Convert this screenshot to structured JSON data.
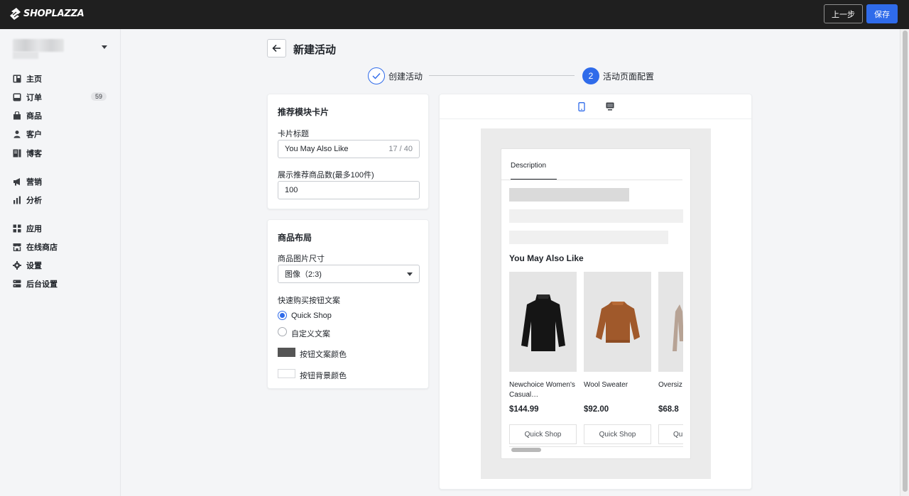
{
  "topbar": {
    "logo_text": "SHOPLAZZA",
    "prev_label": "上一步",
    "save_label": "保存",
    "colors": {
      "bar": "#1f1f1f",
      "primary": "#2f6bea"
    }
  },
  "sidebar": {
    "items": [
      {
        "label": "主页",
        "icon": "home-icon"
      },
      {
        "label": "订单",
        "icon": "inbox-icon",
        "badge": "59"
      },
      {
        "label": "商品",
        "icon": "bag-icon"
      },
      {
        "label": "客户",
        "icon": "person-icon"
      },
      {
        "label": "博客",
        "icon": "blog-icon"
      },
      {
        "label": "营销",
        "icon": "megaphone-icon"
      },
      {
        "label": "分析",
        "icon": "bar-chart-icon"
      },
      {
        "label": "应用",
        "icon": "apps-icon"
      },
      {
        "label": "在线商店",
        "icon": "store-icon"
      },
      {
        "label": "设置",
        "icon": "gear-icon"
      },
      {
        "label": "后台设置",
        "icon": "server-icon"
      }
    ]
  },
  "header": {
    "title": "新建活动"
  },
  "steps": [
    {
      "label": "创建活动",
      "state": "done"
    },
    {
      "number": "2",
      "label": "活动页面配置",
      "state": "active"
    }
  ],
  "card_module": {
    "title": "推荐模块卡片",
    "card_title_label": "卡片标题",
    "card_title_value": "You May Also Like",
    "card_title_counter": "17 / 40",
    "count_label": "展示推荐商品数(最多100件)",
    "count_value": "100"
  },
  "card_layout": {
    "title": "商品布局",
    "image_size_label": "商品图片尺寸",
    "image_size_value": "图像（2:3)",
    "quick_buy_label": "快速购买按钮文案",
    "options": [
      {
        "label": "Quick Shop",
        "selected": true
      },
      {
        "label": "自定义文案",
        "selected": false
      }
    ],
    "text_color_label": "按钮文案颜色",
    "text_color": "#555555",
    "bg_color_label": "按钮背景颜色",
    "bg_color": "#ffffff"
  },
  "preview": {
    "device": "mobile",
    "tab_label": "Description",
    "heading": "You May Also Like",
    "products": [
      {
        "name": "Newchoice Women's Casual…",
        "price": "$144.99",
        "button": "Quick Shop",
        "image": "black-sweater"
      },
      {
        "name": "Wool Sweater",
        "price": "$92.00",
        "button": "Quick Shop",
        "image": "brown-sweater"
      },
      {
        "name": "Oversiz Turtlene",
        "price": "$68.8",
        "button": "Qu",
        "image": "beige-sweater"
      }
    ]
  }
}
